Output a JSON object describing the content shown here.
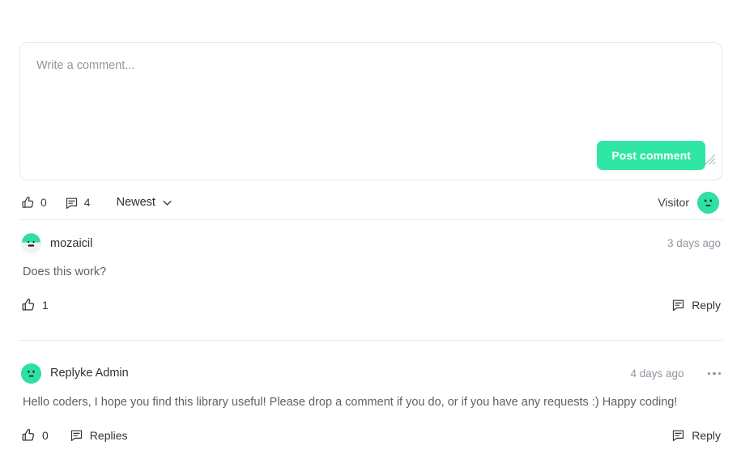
{
  "composer": {
    "placeholder": "Write a comment...",
    "value": "",
    "post_label": "Post comment",
    "post_color": "#2fe6a4"
  },
  "toolbar": {
    "likes_count": "0",
    "comments_count": "4",
    "sort_label": "Newest",
    "visitor_label": "Visitor"
  },
  "comments": [
    {
      "author": "mozaicil",
      "timestamp": "3 days ago",
      "body": "Does this work?",
      "likes_count": "1",
      "reply_label": "Reply",
      "avatar_style": "light",
      "has_menu": false
    },
    {
      "author": "Replyke Admin",
      "timestamp": "4 days ago",
      "body": "Hello coders, I hope you find this library useful! Please drop a comment if you do, or if you have any requests :) Happy coding!",
      "likes_count": "0",
      "replies_label": "Replies",
      "reply_label": "Reply",
      "avatar_style": "green",
      "has_menu": true
    }
  ],
  "colors": {
    "accent_green": "#2fe6a4",
    "avatar_green": "#2fe0a0",
    "divider": "#e8eaec",
    "muted_text": "#8e969f"
  }
}
